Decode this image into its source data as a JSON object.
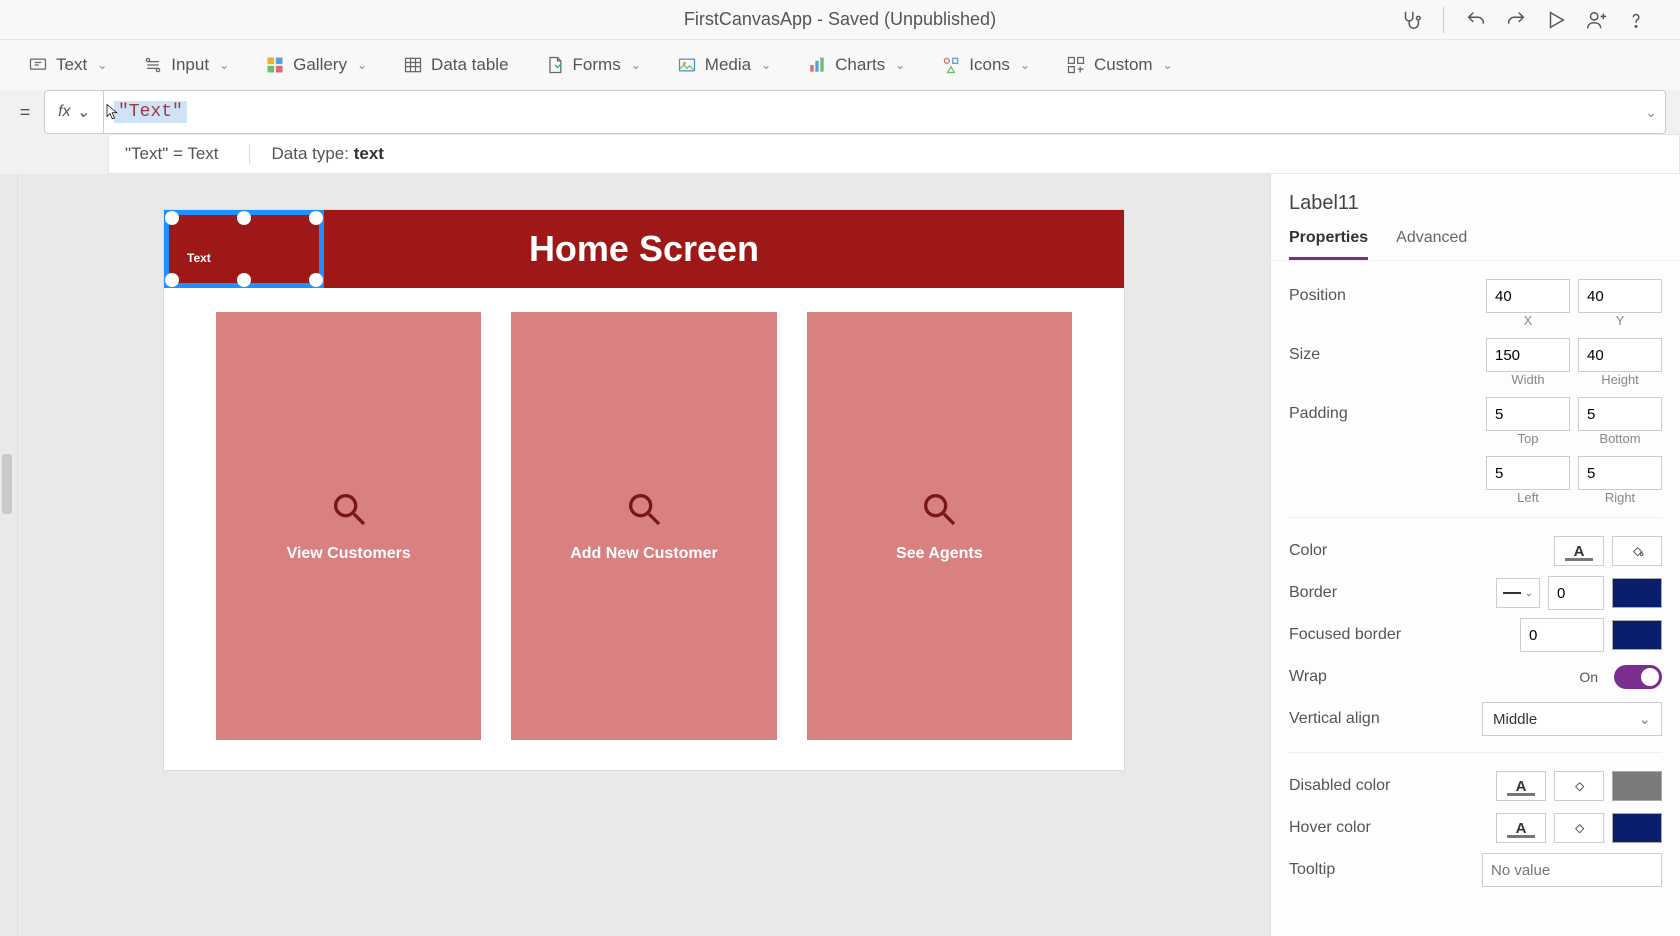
{
  "titlebar": {
    "title": "FirstCanvasApp - Saved (Unpublished)"
  },
  "ribbon": {
    "text": "Text",
    "input": "Input",
    "gallery": "Gallery",
    "dataTable": "Data table",
    "forms": "Forms",
    "media": "Media",
    "charts": "Charts",
    "icons": "Icons",
    "custom": "Custom"
  },
  "formula": {
    "equals": "=",
    "fx": "fx",
    "value": "\"Text\"",
    "hint_left": "\"Text\"  =  Text",
    "hint_right_label": "Data type: ",
    "hint_right_value": "text"
  },
  "canvas": {
    "header_title": "Home Screen",
    "selected_label_text": "Text",
    "cards": [
      {
        "label": "View Customers"
      },
      {
        "label": "Add New Customer"
      },
      {
        "label": "See Agents"
      }
    ]
  },
  "panel": {
    "name": "Label11",
    "tabs": {
      "properties": "Properties",
      "advanced": "Advanced"
    },
    "position": {
      "label": "Position",
      "x": "40",
      "y": "40",
      "xl": "X",
      "yl": "Y"
    },
    "size": {
      "label": "Size",
      "w": "150",
      "h": "40",
      "wl": "Width",
      "hl": "Height"
    },
    "padding": {
      "label": "Padding",
      "t": "5",
      "b": "5",
      "l": "5",
      "r": "5",
      "tl": "Top",
      "bl": "Bottom",
      "ll": "Left",
      "rl": "Right"
    },
    "color": {
      "label": "Color"
    },
    "border": {
      "label": "Border",
      "width": "0"
    },
    "focused": {
      "label": "Focused border",
      "width": "0"
    },
    "wrap": {
      "label": "Wrap",
      "on": "On"
    },
    "valign": {
      "label": "Vertical align",
      "value": "Middle"
    },
    "disabled": {
      "label": "Disabled color"
    },
    "hover": {
      "label": "Hover color"
    },
    "tooltip": {
      "label": "Tooltip",
      "placeholder": "No value"
    }
  }
}
